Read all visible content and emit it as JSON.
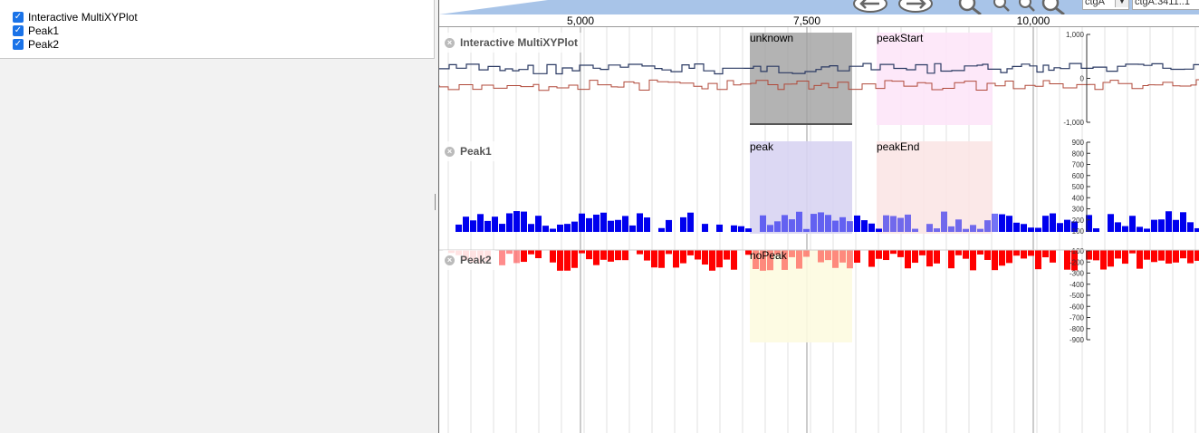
{
  "track_list": {
    "items": [
      {
        "label": "Interactive MultiXYPlot",
        "checked": true
      },
      {
        "label": "Peak1",
        "checked": true
      },
      {
        "label": "Peak2",
        "checked": true
      }
    ]
  },
  "ruler": {
    "labels": [
      "5,000",
      "7,500",
      "10,000"
    ],
    "positions_bp": [
      5000,
      7500,
      10000
    ]
  },
  "nav": {
    "ref_select": "ctgA",
    "location": "ctgA:3411..1",
    "icons": [
      "pan-left-icon",
      "pan-right-icon",
      "zoom-out-big-icon",
      "zoom-out-icon",
      "zoom-in-icon",
      "zoom-in-big-icon"
    ]
  },
  "tracks": [
    {
      "name": "Interactive MultiXYPlot",
      "axis": [
        "1,000",
        "0",
        "-1,000"
      ]
    },
    {
      "name": "Peak1",
      "axis": [
        "900",
        "800",
        "700",
        "600",
        "500",
        "400",
        "300",
        "200",
        "100"
      ]
    },
    {
      "name": "Peak2",
      "axis": [
        "-100",
        "-200",
        "-300",
        "-400",
        "-500",
        "-600",
        "-700",
        "-800",
        "-900"
      ]
    }
  ],
  "regions": [
    {
      "label": "unknown",
      "color": "#a0a0a0"
    },
    {
      "label": "peakStart",
      "color": "#fde6f8"
    },
    {
      "label": "peak",
      "color": "#d8d4f2"
    },
    {
      "label": "peakEnd",
      "color": "#fbe6e6"
    },
    {
      "label": "noPeak",
      "color": "#fdfbe0"
    }
  ],
  "colors": {
    "series_top": "#2b3a63",
    "series_bottom": "#b0493a",
    "peak1": "#0000ee",
    "peak2": "#ff0000"
  }
}
